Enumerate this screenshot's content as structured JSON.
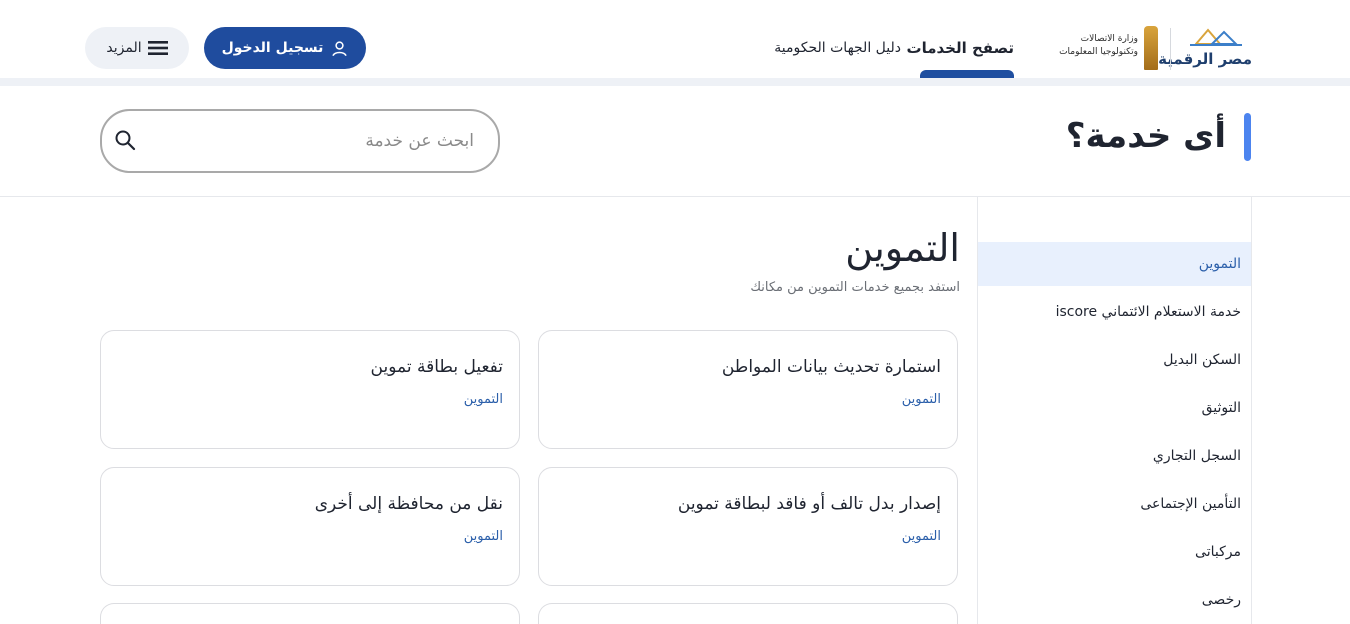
{
  "header": {
    "logo_digital_text": "مصر الرقمية",
    "logo_ministry_line1": "وزارة الاتصالات",
    "logo_ministry_line2": "وتكنولوجيا المعلومات",
    "nav": {
      "browse_services": "تصفح الخدمات",
      "gov_directory": "دليل الجهات الحكومية"
    },
    "login_label": "تسجيل الدخول",
    "more_label": "المزيد",
    "brand_color": "#1f4c9e"
  },
  "search": {
    "title": "أى خدمة؟",
    "placeholder": "ابحث عن خدمة",
    "value": ""
  },
  "sidebar": {
    "items": [
      {
        "label": "التموين",
        "active": true
      },
      {
        "label": "خدمة الاستعلام الائتماني iscore",
        "active": false
      },
      {
        "label": "السكن البديل",
        "active": false
      },
      {
        "label": "التوثيق",
        "active": false
      },
      {
        "label": "السجل التجاري",
        "active": false
      },
      {
        "label": "التأمين الإجتماعى",
        "active": false
      },
      {
        "label": "مركباتى",
        "active": false
      },
      {
        "label": "رخصى",
        "active": false
      }
    ]
  },
  "category": {
    "title": "التموين",
    "subtitle": "استفد بجميع خدمات التموين من مكانك",
    "cards": [
      {
        "title": "استمارة تحديث بيانات المواطن",
        "tag": "التموين"
      },
      {
        "title": "تفعيل بطاقة تموين",
        "tag": "التموين"
      },
      {
        "title": "إصدار بدل تالف أو فاقد لبطاقة تموين",
        "tag": "التموين"
      },
      {
        "title": "نقل من محافظة إلى أخرى",
        "tag": "التموين"
      },
      {
        "title": "",
        "tag": ""
      },
      {
        "title": "",
        "tag": ""
      }
    ]
  }
}
